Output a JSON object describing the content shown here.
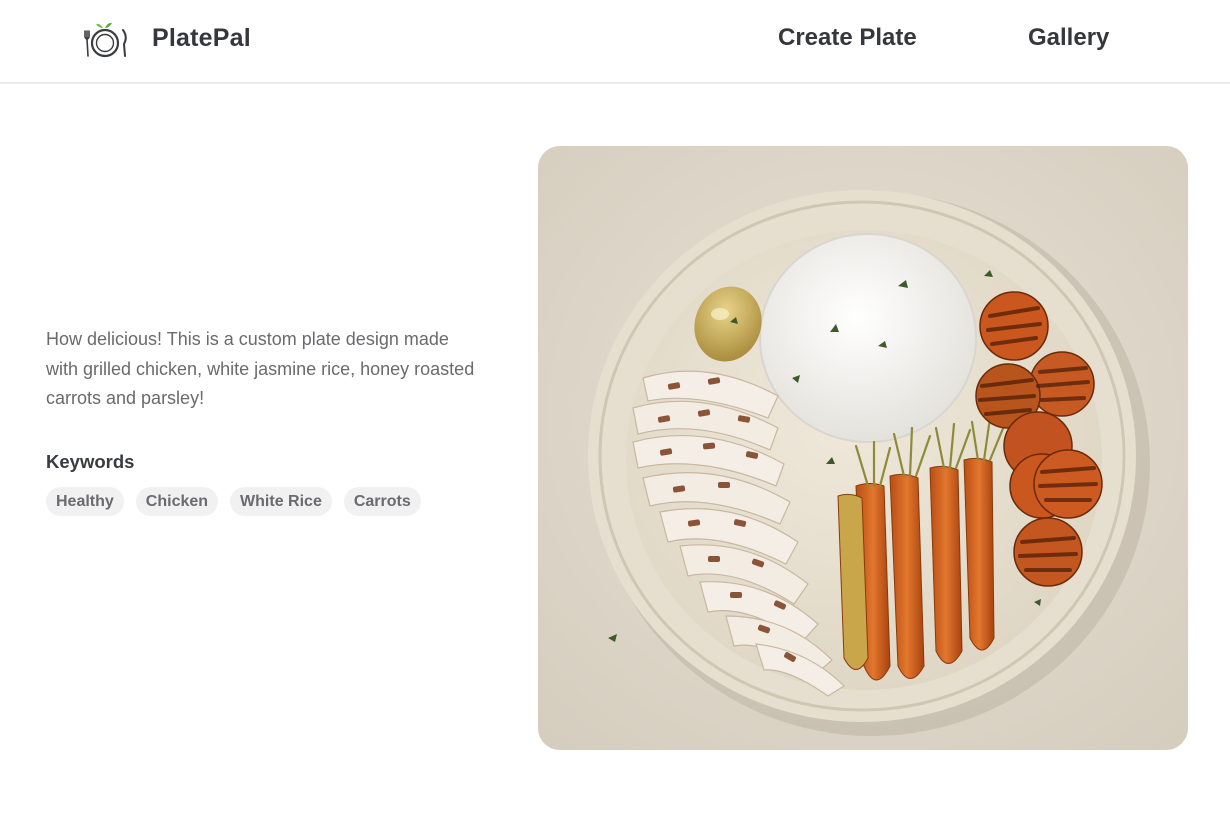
{
  "header": {
    "brand": "PlatePal",
    "logo_icon": "plate-with-fork-knife-icon",
    "nav": {
      "create_plate": "Create Plate",
      "gallery": "Gallery"
    }
  },
  "main": {
    "description": "How delicious! This is a custom plate design made with grilled chicken, white jasmine rice, honey roasted carrots and parsley!",
    "keywords_heading": "Keywords",
    "keywords": [
      "Healthy",
      "Chicken",
      "White Rice",
      "Carrots"
    ],
    "image": {
      "subject": "plate-of-grilled-chicken-rice-carrots"
    }
  },
  "colors": {
    "text_dark": "#36373d",
    "text_muted": "#6a6a6f",
    "chip_bg": "#f1f1f2",
    "logo_leaf": "#6dbb3a"
  }
}
